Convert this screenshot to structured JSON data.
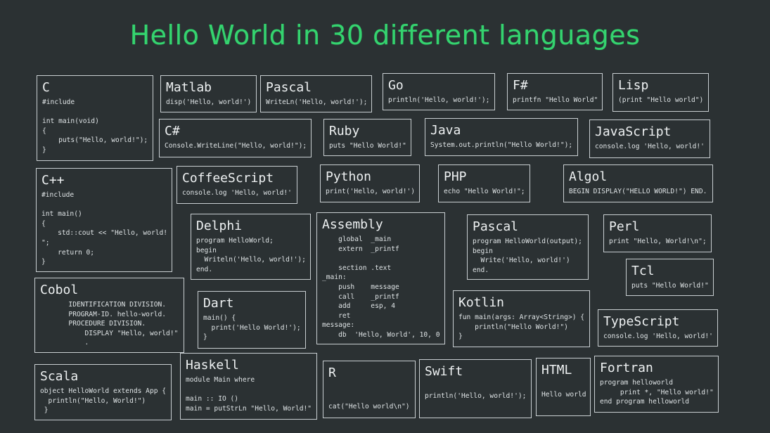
{
  "title": "Hello World in 30 different languages",
  "cards": {
    "c": {
      "name": "C",
      "lines": [
        "#include",
        "",
        "int main(void)",
        "{",
        "    puts(\"Hello, world!\");",
        "}"
      ]
    },
    "matlab": {
      "name": "Matlab",
      "lines": [
        "disp('Hello, world!')"
      ]
    },
    "pascal1": {
      "name": "Pascal",
      "lines": [
        "WriteLn('Hello, world!');"
      ]
    },
    "go": {
      "name": "Go",
      "lines": [
        "println('Hello, world!');"
      ]
    },
    "fsharp": {
      "name": "F#",
      "lines": [
        "printfn \"Hello World\""
      ]
    },
    "lisp": {
      "name": "Lisp",
      "lines": [
        "(print \"Hello world\")"
      ]
    },
    "csharp": {
      "name": "C#",
      "lines": [
        "Console.WriteLine(\"Hello, world!\");"
      ]
    },
    "ruby": {
      "name": "Ruby",
      "lines": [
        "puts \"Hello World!\""
      ]
    },
    "java": {
      "name": "Java",
      "lines": [
        "System.out.println(\"Hello World!\");"
      ]
    },
    "javascript": {
      "name": "JavaScript",
      "lines": [
        "console.log 'Hello, world!'"
      ]
    },
    "cpp": {
      "name": "C++",
      "lines": [
        "#include",
        "",
        "int main()",
        "{",
        "    std::cout << \"Hello, world!",
        "\";",
        "    return 0;",
        "}"
      ]
    },
    "coffeescript": {
      "name": "CoffeeScript",
      "lines": [
        "console.log 'Hello, world!'"
      ]
    },
    "python": {
      "name": "Python",
      "lines": [
        "print('Hello, world!')"
      ]
    },
    "php": {
      "name": "PHP",
      "lines": [
        "echo \"Hello World!\";"
      ]
    },
    "algol": {
      "name": "Algol",
      "lines": [
        "BEGIN DISPLAY(\"HELLO WORLD!\") END."
      ]
    },
    "delphi": {
      "name": "Delphi",
      "lines": [
        "program HelloWorld;",
        "begin",
        "  Writeln('Hello, world!');",
        "end."
      ]
    },
    "assembly": {
      "name": "Assembly",
      "lines": [
        "    global  _main",
        "    extern  _printf",
        "",
        "    section .text",
        "_main:",
        "    push    message",
        "    call    _printf",
        "    add     esp, 4",
        "    ret",
        "message:",
        "    db  'Hello, World', 10, 0"
      ]
    },
    "pascal2": {
      "name": "Pascal",
      "lines": [
        "program HelloWorld(output);",
        "begin",
        "  Write('Hello, world!')",
        "end."
      ]
    },
    "perl": {
      "name": "Perl",
      "lines": [
        "print \"Hello, World!\\n\";"
      ]
    },
    "tcl": {
      "name": "Tcl",
      "lines": [
        "puts \"Hello World!\""
      ]
    },
    "cobol": {
      "name": "Cobol",
      "lines": [
        "       IDENTIFICATION DIVISION.",
        "       PROGRAM-ID. hello-world.",
        "       PROCEDURE DIVISION.",
        "           DISPLAY \"Hello, world!\"",
        "           ."
      ]
    },
    "dart": {
      "name": "Dart",
      "lines": [
        "main() {",
        "  print('Hello World!');",
        "}"
      ]
    },
    "kotlin": {
      "name": "Kotlin",
      "lines": [
        "fun main(args: Array<String>) {",
        "    println(\"Hello World!\")",
        "}"
      ]
    },
    "typescript": {
      "name": "TypeScript",
      "lines": [
        "console.log 'Hello, world!'"
      ]
    },
    "scala": {
      "name": "Scala",
      "lines": [
        "object HelloWorld extends App {",
        "  println(\"Hello, World!\")",
        " }"
      ]
    },
    "haskell": {
      "name": "Haskell",
      "lines": [
        "module Main where",
        "",
        "main :: IO ()",
        "main = putStrLn \"Hello, World!\""
      ]
    },
    "r": {
      "name": "R",
      "lines": [
        "",
        "",
        "cat(\"Hello world\\n\")"
      ]
    },
    "swift": {
      "name": "Swift",
      "lines": [
        "",
        "println('Hello, world!');"
      ]
    },
    "html": {
      "name": "HTML",
      "lines": [
        "",
        "Hello world"
      ]
    },
    "fortran": {
      "name": "Fortran",
      "lines": [
        "program helloworld",
        "     print *, \"Hello world!\"",
        "end program helloworld"
      ]
    }
  }
}
